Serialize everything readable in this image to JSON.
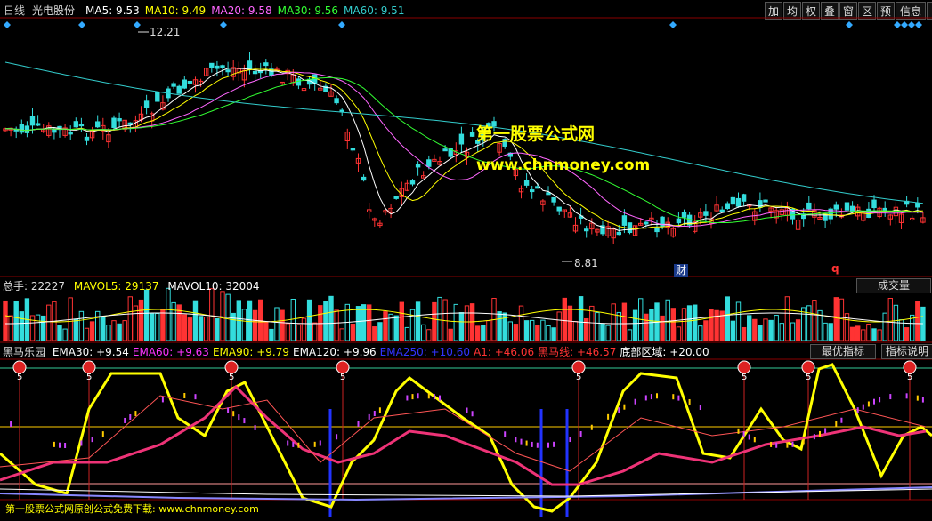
{
  "header": {
    "period": "日线",
    "stock": "光电股份",
    "ma": [
      {
        "label": "MA5: ",
        "value": "9.53",
        "color": "#ffffff"
      },
      {
        "label": "MA10: ",
        "value": "9.49",
        "color": "#ffff00"
      },
      {
        "label": "MA20: ",
        "value": "9.58",
        "color": "#ff66ff"
      },
      {
        "label": "MA30: ",
        "value": "9.56",
        "color": "#33ff33"
      },
      {
        "label": "MA60: ",
        "value": "9.51",
        "color": "#33cccc"
      }
    ],
    "toolbar": [
      "加",
      "均",
      "权",
      "叠",
      "窗",
      "区",
      "预",
      "信息",
      "▶|"
    ]
  },
  "price": {
    "high_mark": "12.21",
    "low_mark": "8.81",
    "cai_badge": "财",
    "q_mark": "q"
  },
  "watermark": {
    "title": "第一股票公式网",
    "url": "www.chnmoney.com"
  },
  "volume": {
    "label": "总手: ",
    "value": "22227",
    "mavol5_label": "MAVOL5: ",
    "mavol5": "29137",
    "mavol10_label": "MAVOL10: ",
    "mavol10": "32004",
    "dropdown": "成交量"
  },
  "indicator": {
    "name": "黑马乐园",
    "items": [
      {
        "label": "EMA30: ",
        "value": "+9.54",
        "color": "#ffffff"
      },
      {
        "label": "EMA60: ",
        "value": "+9.63",
        "color": "#ff33ff"
      },
      {
        "label": "EMA90: ",
        "value": "+9.79",
        "color": "#ffff00"
      },
      {
        "label": "EMA120: ",
        "value": "+9.96",
        "color": "#ffffff"
      },
      {
        "label": "EMA250: ",
        "value": "+10.60",
        "color": "#3333ff"
      },
      {
        "label": "A1: ",
        "value": "+46.06",
        "color": "#ff3333"
      },
      {
        "label": "黑马线: ",
        "value": "+46.57",
        "color": "#ff3333"
      },
      {
        "label": "底部区域: ",
        "value": "+20.00",
        "color": "#ffffff"
      }
    ],
    "btn_optimal": "最优指标",
    "btn_explain": "指标说明",
    "signal_num": "5",
    "footer": "第一股票公式网原创公式免费下载: www.chnmoney.com"
  },
  "colors": {
    "up": "#ff3333",
    "down": "#33dddd",
    "bg": "#000000",
    "grid": "#8a0000"
  }
}
